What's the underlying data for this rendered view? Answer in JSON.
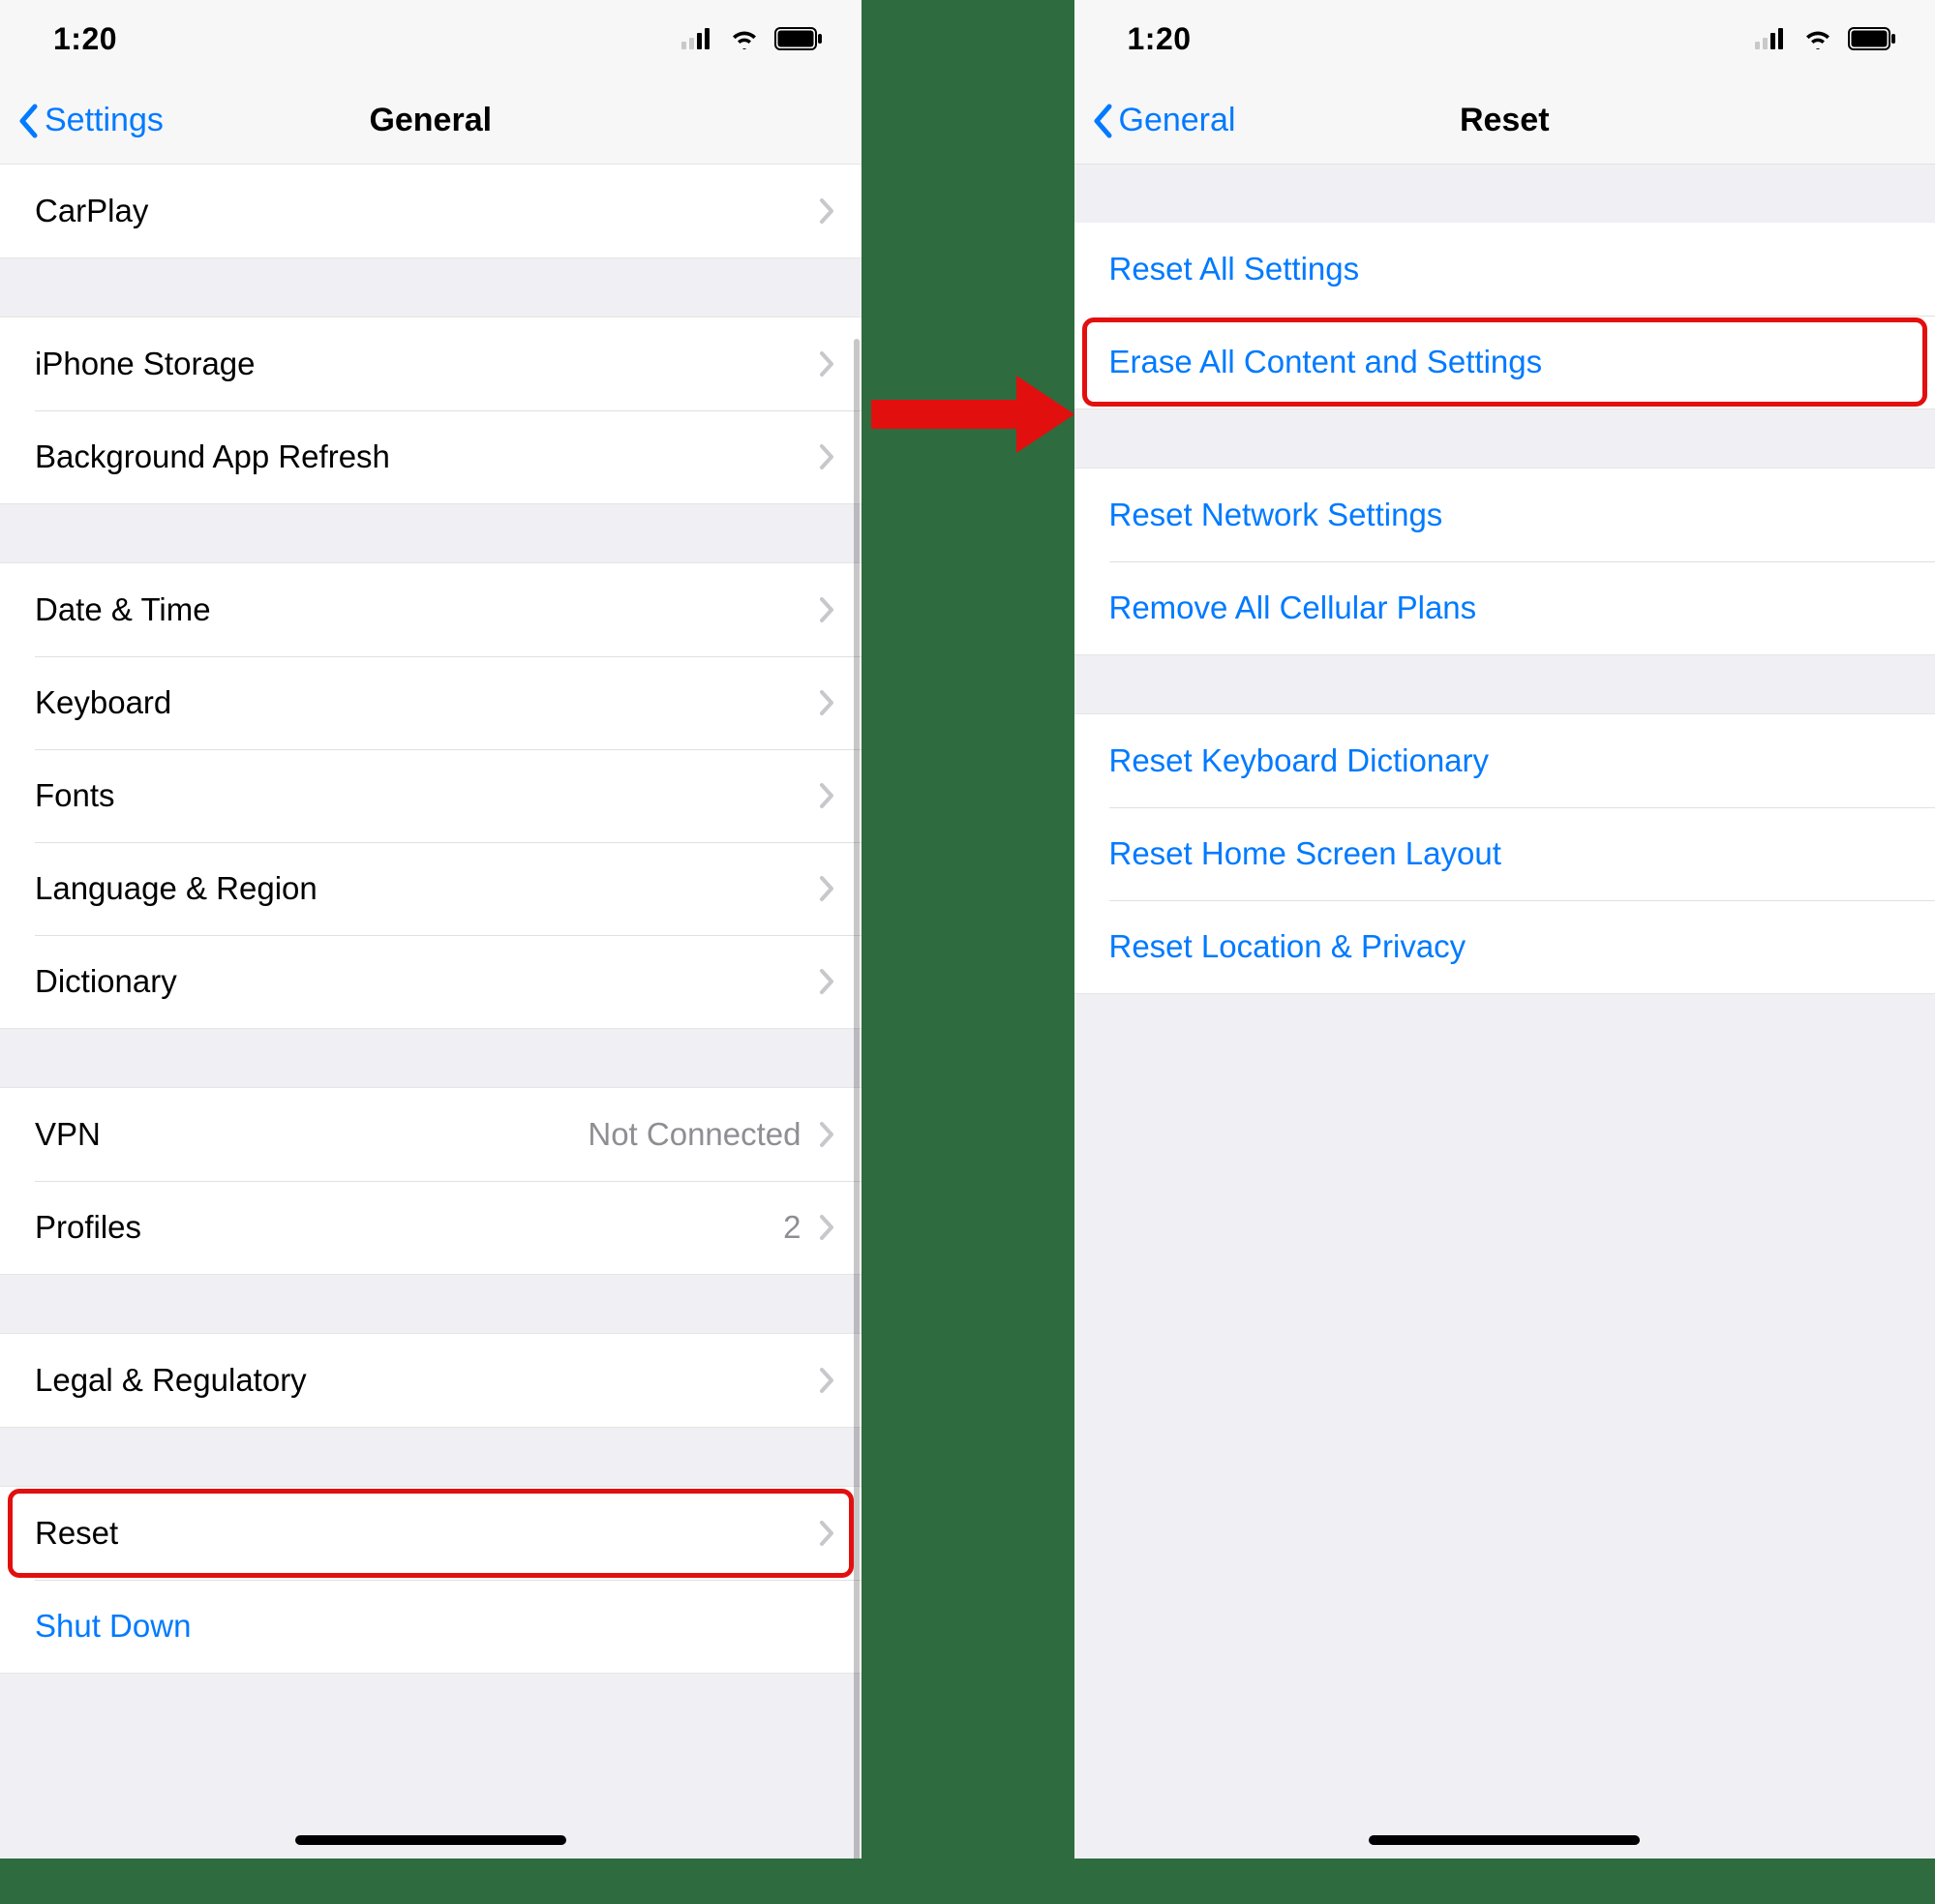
{
  "status": {
    "time": "1:20"
  },
  "left": {
    "back_label": "Settings",
    "title": "General",
    "groups": [
      [
        {
          "label": "CarPlay",
          "chevron": true
        }
      ],
      [
        {
          "label": "iPhone Storage",
          "chevron": true
        },
        {
          "label": "Background App Refresh",
          "chevron": true
        }
      ],
      [
        {
          "label": "Date & Time",
          "chevron": true
        },
        {
          "label": "Keyboard",
          "chevron": true
        },
        {
          "label": "Fonts",
          "chevron": true
        },
        {
          "label": "Language & Region",
          "chevron": true
        },
        {
          "label": "Dictionary",
          "chevron": true
        }
      ],
      [
        {
          "label": "VPN",
          "detail": "Not Connected",
          "chevron": true
        },
        {
          "label": "Profiles",
          "detail": "2",
          "chevron": true
        }
      ],
      [
        {
          "label": "Legal & Regulatory",
          "chevron": true
        }
      ],
      [
        {
          "label": "Reset",
          "chevron": true,
          "highlight": true
        },
        {
          "label": "Shut Down",
          "blue": true
        }
      ]
    ]
  },
  "right": {
    "back_label": "General",
    "title": "Reset",
    "groups": [
      [
        {
          "label": "Reset All Settings"
        },
        {
          "label": "Erase All Content and Settings",
          "highlight": true
        }
      ],
      [
        {
          "label": "Reset Network Settings"
        },
        {
          "label": "Remove All Cellular Plans"
        }
      ],
      [
        {
          "label": "Reset Keyboard Dictionary"
        },
        {
          "label": "Reset Home Screen Layout"
        },
        {
          "label": "Reset Location & Privacy"
        }
      ]
    ]
  }
}
